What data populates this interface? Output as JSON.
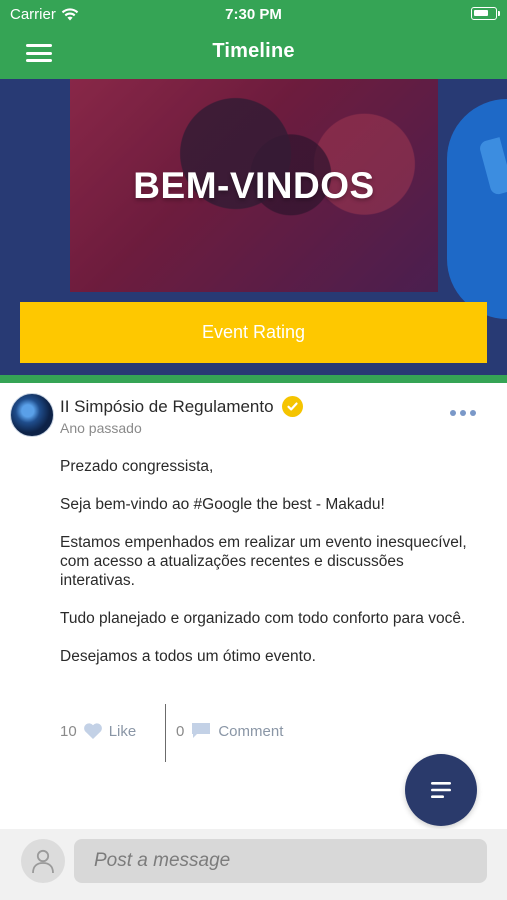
{
  "status": {
    "carrier": "Carrier",
    "time": "7:30 PM"
  },
  "nav": {
    "title": "Timeline",
    "menu_icon": "hamburger-icon"
  },
  "banner": {
    "title": "BEM-VINDOS",
    "rating_button": "Event Rating"
  },
  "post": {
    "author": "II Simpósio de Regulamento",
    "time": "Ano passado",
    "verified": true,
    "body": [
      "Prezado congressista,",
      "Seja bem-vindo ao #Google the best - Makadu!",
      "Estamos empenhados em realizar um evento inesquecível, com acesso a atualizações recentes e discussões interativas.",
      "Tudo planejado e organizado com todo conforto para você.",
      "Desejamos a todos um ótimo evento."
    ],
    "likes": {
      "count": "10",
      "label": "Like"
    },
    "comments": {
      "count": "0",
      "label": "Comment"
    }
  },
  "composer": {
    "placeholder": "Post a message"
  },
  "colors": {
    "green": "#35a455",
    "yellow": "#fec800",
    "navy": "#2a3a6b"
  }
}
